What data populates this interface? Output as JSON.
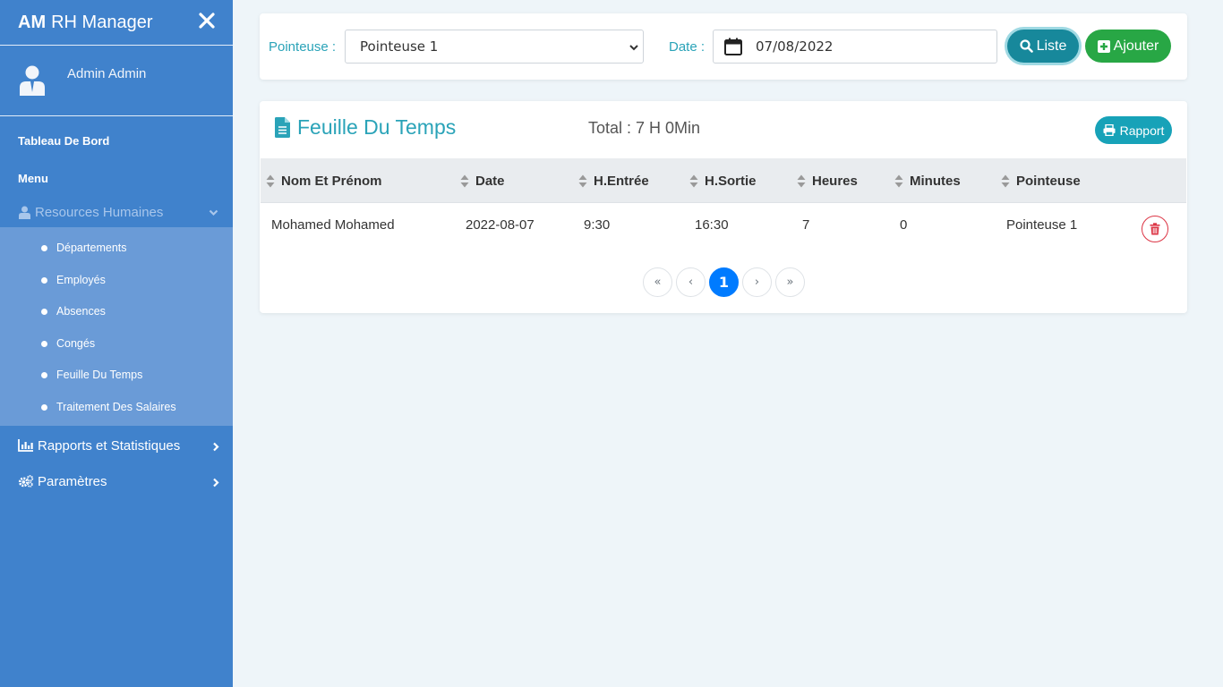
{
  "app": {
    "brand_bold": "AM",
    "brand_rest": "RH Manager"
  },
  "user": {
    "name": "Admin Admin"
  },
  "sidebar": {
    "dashboard": "Tableau De Bord",
    "menu": "Menu",
    "group": "Resources Humaines",
    "sub_items": [
      {
        "label": "Départements"
      },
      {
        "label": "Employés"
      },
      {
        "label": "Absences"
      },
      {
        "label": "Congés"
      },
      {
        "label": "Feuille Du Temps"
      },
      {
        "label": "Traitement Des Salaires"
      }
    ],
    "reports": "Rapports et Statistiques",
    "settings": "Paramètres"
  },
  "filter": {
    "pointeuse_label": "Pointeuse :",
    "pointeuse_value": "Pointeuse 1",
    "date_label": "Date :",
    "date_value": "07/08/2022",
    "liste_label": "Liste",
    "ajouter_label": "Ajouter"
  },
  "sheet": {
    "title": "Feuille Du Temps",
    "total": "Total : 7 H 0Min",
    "rapport_label": "Rapport",
    "columns": [
      "Nom Et Prénom",
      "Date",
      "H.Entrée",
      "H.Sortie",
      "Heures",
      "Minutes",
      "Pointeuse"
    ],
    "rows": [
      [
        "Mohamed Mohamed",
        "2022-08-07",
        "9:30",
        "16:30",
        "7",
        "0",
        "Pointeuse 1"
      ]
    ]
  },
  "pagination": {
    "first": "«",
    "prev": "‹",
    "current": "1",
    "next": "›",
    "last": "»"
  },
  "colors": {
    "sidebar": "#4082cc",
    "submenu": "#6a9bd7",
    "accent": "#17a2b8",
    "success": "#28a745",
    "danger": "#dc3545",
    "page_active": "#007bff"
  }
}
